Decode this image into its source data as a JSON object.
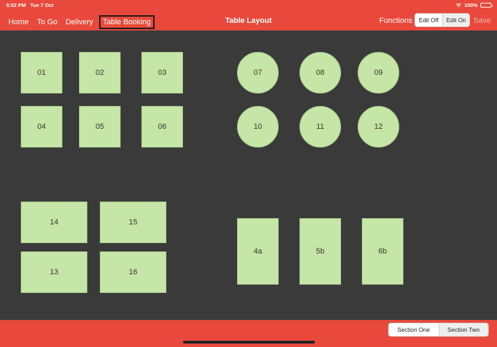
{
  "status_bar": {
    "time": "5:02 PM",
    "date": "Tue 7 Oct",
    "battery": "100%"
  },
  "nav": [
    {
      "label": "Home"
    },
    {
      "label": "To Go"
    },
    {
      "label": "Delivery"
    },
    {
      "label": "Table Booking",
      "selected": true
    }
  ],
  "title": "Table Layout",
  "functions_label": "Functions",
  "edit_toggle": {
    "off_label": "Edit Off",
    "on_label": "Edit On",
    "selected": "Edit Off"
  },
  "save_label": "Save",
  "tables": [
    {
      "label": "01",
      "shape": "square"
    },
    {
      "label": "02",
      "shape": "square"
    },
    {
      "label": "03",
      "shape": "square"
    },
    {
      "label": "04",
      "shape": "square"
    },
    {
      "label": "05",
      "shape": "square"
    },
    {
      "label": "06",
      "shape": "square"
    },
    {
      "label": "07",
      "shape": "round"
    },
    {
      "label": "08",
      "shape": "round"
    },
    {
      "label": "09",
      "shape": "round"
    },
    {
      "label": "10",
      "shape": "round"
    },
    {
      "label": "11",
      "shape": "round"
    },
    {
      "label": "12",
      "shape": "round"
    },
    {
      "label": "14",
      "shape": "rect-wide"
    },
    {
      "label": "15",
      "shape": "rect-wide"
    },
    {
      "label": "13",
      "shape": "rect-wide"
    },
    {
      "label": "16",
      "shape": "rect-wide"
    },
    {
      "label": "4a",
      "shape": "rect-tall"
    },
    {
      "label": "5b",
      "shape": "rect-tall"
    },
    {
      "label": "6b",
      "shape": "rect-tall"
    }
  ],
  "sections": {
    "one_label": "Section One",
    "two_label": "Section Two",
    "selected": "Section One"
  },
  "colors": {
    "bar": "#e8493c",
    "floor": "#3a3a3a",
    "table": "#c5e6a6"
  }
}
